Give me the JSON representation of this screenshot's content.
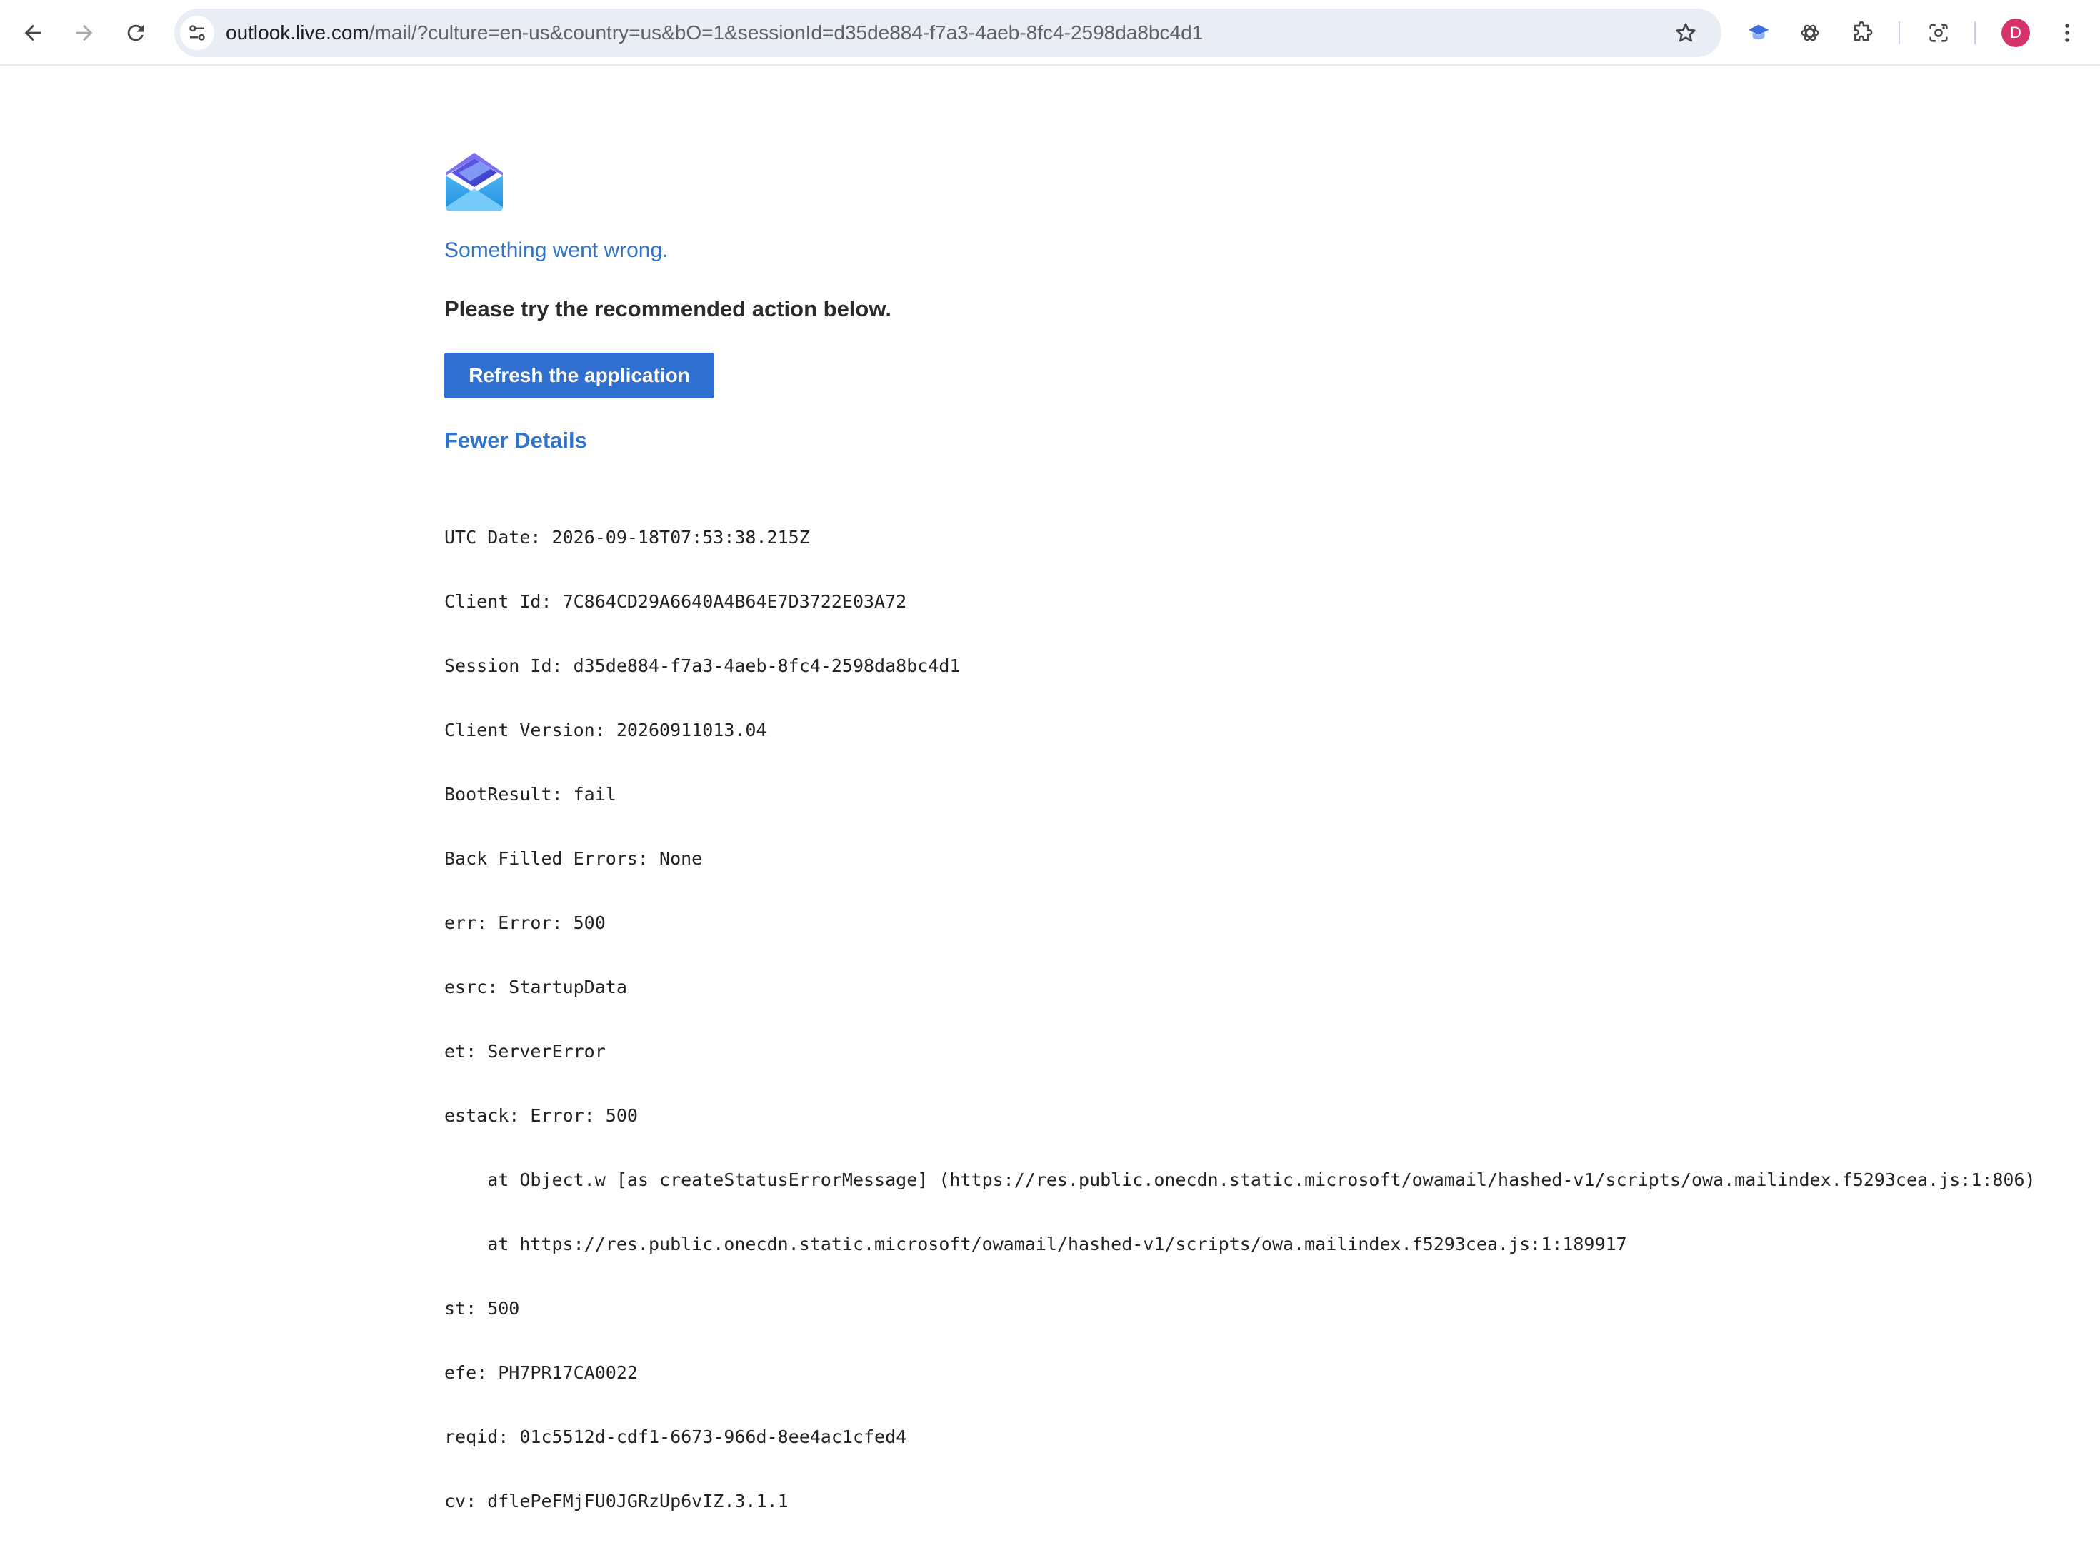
{
  "browser": {
    "url_host": "outlook.live.com",
    "url_path": "/mail/?culture=en-us&country=us&bO=1&sessionId=d35de884-f7a3-4aeb-8fc4-2598da8bc4d1",
    "profile_initial": "D",
    "icons": {
      "back": "back-arrow-icon",
      "forward": "forward-arrow-icon",
      "reload": "reload-icon",
      "site_info": "tune-icon",
      "bookmark": "star-icon",
      "extension1": "graduation-cap-icon",
      "extension2": "openai-icon",
      "extensions": "puzzle-icon",
      "lens": "lens-icon",
      "menu": "kebab-menu-icon"
    }
  },
  "error": {
    "title": "Something went wrong.",
    "action_text": "Please try the recommended action below.",
    "refresh_label": "Refresh the application",
    "details_toggle": "Fewer Details",
    "details": [
      "UTC Date: 2026-09-18T07:53:38.215Z",
      "Client Id: 7C864CD29A6640A4B64E7D3722E03A72",
      "Session Id: d35de884-f7a3-4aeb-8fc4-2598da8bc4d1",
      "Client Version: 20260911013.04",
      "BootResult: fail",
      "Back Filled Errors: None",
      "err: Error: 500",
      "esrc: StartupData",
      "et: ServerError",
      "estack: Error: 500",
      "    at Object.w [as createStatusErrorMessage] (https://res.public.onecdn.static.microsoft/owamail/hashed-v1/scripts/owa.mailindex.f5293cea.js:1:806)",
      "    at https://res.public.onecdn.static.microsoft/owamail/hashed-v1/scripts/owa.mailindex.f5293cea.js:1:189917",
      "st: 500",
      "efe: PH7PR17CA0022",
      "reqid: 01c5512d-cdf1-6673-966d-8ee4ac1cfed4",
      "cv: dflePeFMjFU0JGRzUp6vIZ.3.1.1"
    ]
  },
  "colors": {
    "accent_blue": "#2f74c8",
    "button_blue": "#2f6fcf",
    "avatar": "#d6336c"
  }
}
